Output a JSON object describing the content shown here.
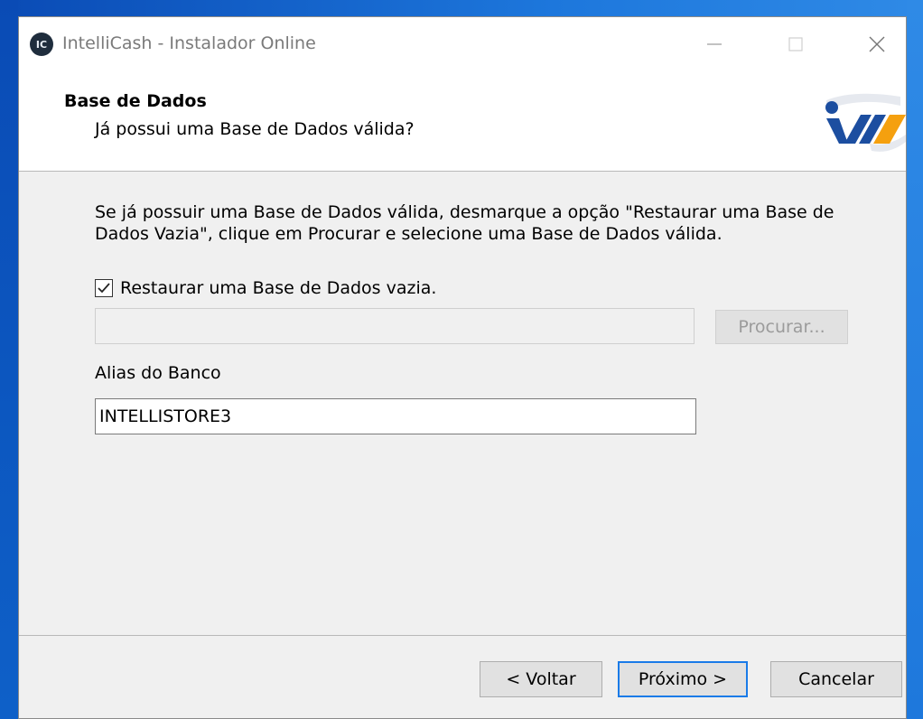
{
  "window": {
    "title": "IntelliCash - Instalador Online",
    "icon_text": "IC",
    "controls": [
      "minimize-icon",
      "maximize-icon",
      "close-icon"
    ]
  },
  "header": {
    "title": "Base de Dados",
    "subtitle": "Já possui uma Base de Dados válida?"
  },
  "content": {
    "description": "Se já possuir uma Base de Dados válida, desmarque a opção \"Restaurar uma Base de Dados Vazia\", clique em Procurar e selecione uma Base de Dados válida.",
    "restore_checkbox": {
      "label": "Restaurar uma Base de Dados vazia.",
      "checked": true
    },
    "path_input": {
      "value": ""
    },
    "browse_button": "Procurar...",
    "alias_label": "Alias do Banco",
    "alias_input": {
      "value": "INTELLISTORE3"
    }
  },
  "footer": {
    "back_button": "< Voltar",
    "next_button": "Próximo >",
    "cancel_button": "Cancelar"
  },
  "colors": {
    "logo_blue": "#1c4ea0",
    "logo_orange": "#f5a00f",
    "focus_blue": "#1a7be8"
  }
}
